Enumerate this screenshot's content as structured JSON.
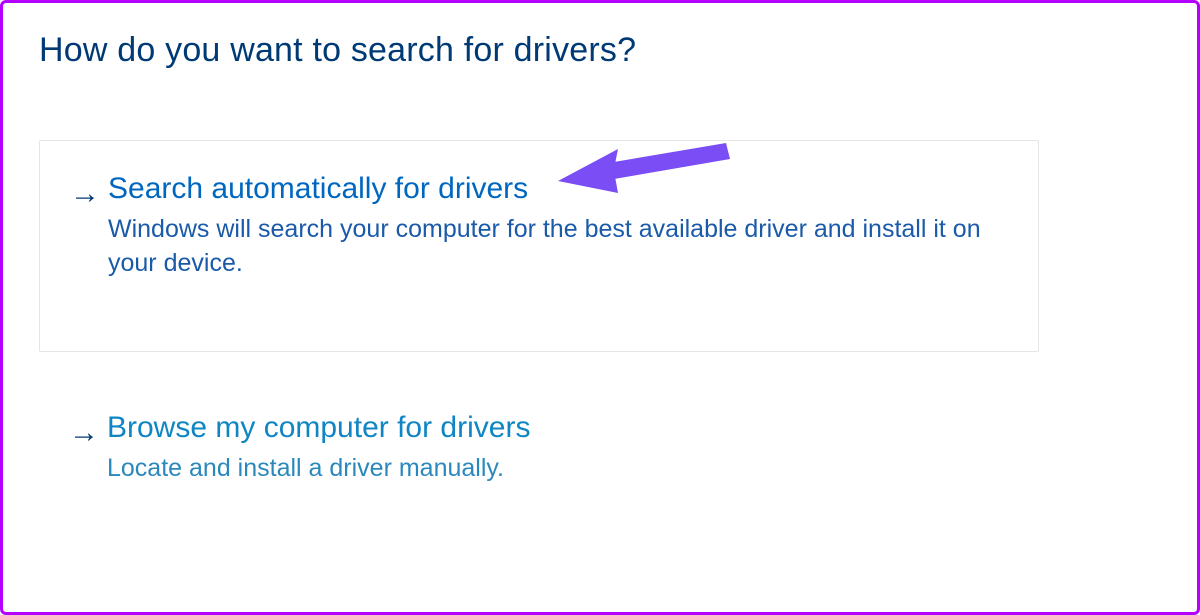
{
  "dialog": {
    "heading": "How do you want to search for drivers?",
    "options": [
      {
        "id": "search-automatically",
        "arrow_glyph": "→",
        "title": "Search automatically for drivers",
        "description": "Windows will search your computer for the best available driver and install it on your device."
      },
      {
        "id": "browse-my-computer",
        "arrow_glyph": "→",
        "title": "Browse my computer for drivers",
        "description": "Locate and install a driver manually."
      }
    ]
  },
  "colors": {
    "frame_border": "#b300ff",
    "heading_text": "#003a75",
    "link_title": "#0067c0",
    "link_title_alt": "#0f86c3",
    "desc_text": "#1a5aa8",
    "annotation_arrow": "#7a4df5"
  },
  "annotation": {
    "target_option_index": 0,
    "icon": "pointer-arrow"
  }
}
